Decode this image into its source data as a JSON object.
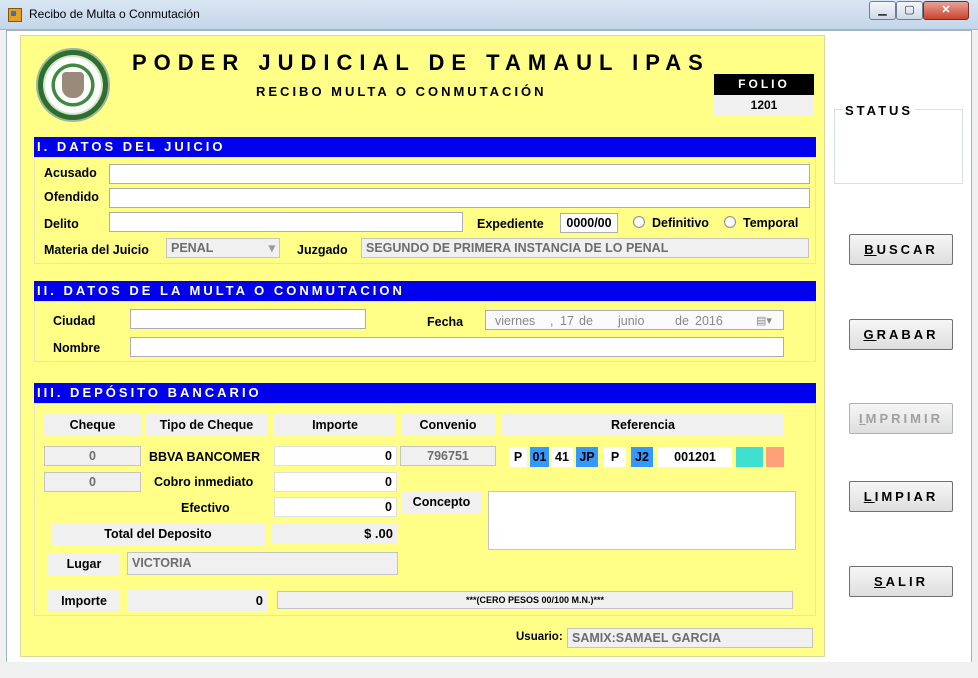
{
  "window": {
    "title": "Recibo de Multa o Conmutación",
    "min": "▁",
    "max": "▢",
    "close": "✕"
  },
  "header": {
    "org": "PODER JUDICIAL DE TAMAUL IPAS",
    "doc": "RECIBO MULTA O CONMUTACIÓN",
    "folio_label": "FOLIO",
    "folio_value": "1201"
  },
  "status": {
    "label": "STATUS"
  },
  "sec1": {
    "title": "I. DATOS DEL JUICIO",
    "acusado_label": "Acusado",
    "ofendido_label": "Ofendido",
    "delito_label": "Delito",
    "expediente_label": "Expediente",
    "expediente_value": "0000/00",
    "definitivo_label": "Definitivo",
    "temporal_label": "Temporal",
    "materia_label": "Materia del Juicio",
    "materia_value": "PENAL",
    "juzgado_label": "Juzgado",
    "juzgado_value": "SEGUNDO DE PRIMERA INSTANCIA DE LO PENAL"
  },
  "sec2": {
    "title": "II. DATOS DE LA MULTA O CONMUTACION",
    "ciudad_label": "Ciudad",
    "nombre_label": "Nombre",
    "fecha_label": "Fecha",
    "fecha_dia": "viernes",
    "fecha_num": "17",
    "fecha_de1": "de",
    "fecha_mes": "junio",
    "fecha_de2": "de",
    "fecha_anio": "2016"
  },
  "sec3": {
    "title": "III. DEPÓSITO BANCARIO",
    "col_cheque": "Cheque",
    "col_tipo": "Tipo de Cheque",
    "col_importe": "Importe",
    "col_convenio": "Convenio",
    "col_referencia": "Referencia",
    "cheque1": "0",
    "cheque2": "0",
    "tipo1": "BBVA BANCOMER",
    "tipo2": "Cobro inmediato",
    "tipo3": "Efectivo",
    "importe1": "0",
    "importe2": "0",
    "importe3": "0",
    "convenio_value": "796751",
    "ref": [
      "P",
      "01",
      "41",
      "JP",
      "P",
      "J2",
      "001201"
    ],
    "concepto_label": "Concepto",
    "total_label": "Total del Deposito",
    "total_value": "$ .00",
    "lugar_label": "Lugar",
    "lugar_value": "VICTORIA",
    "importe_label": "Importe",
    "importe_value": "0",
    "letra_value": "***(CERO PESOS  00/100 M.N.)***"
  },
  "usuario": {
    "label": "Usuario:",
    "value": "SAMIX:SAMAEL GARCIA"
  },
  "buttons": {
    "buscar": [
      "B",
      "USCAR"
    ],
    "grabar": [
      "G",
      "RABAR"
    ],
    "imprimir": [
      "I",
      "MPRIMIR"
    ],
    "limpiar": [
      "L",
      "IMPIAR"
    ],
    "salir": [
      "S",
      "ALIR"
    ]
  },
  "colors": {
    "panel": "#ffff88",
    "section_header": "#0000ee",
    "ref_blue": "#3399ff",
    "ref_cyan": "#40e0d0",
    "ref_salmon": "#ffa07a"
  }
}
